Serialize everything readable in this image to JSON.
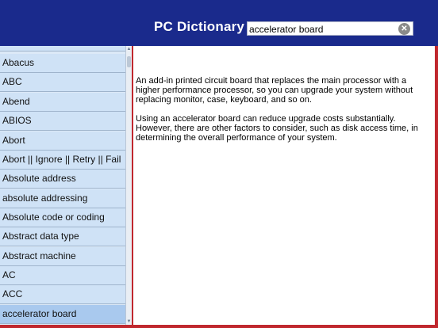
{
  "header": {
    "title": "PC Dictionary",
    "search_value": "accelerator board",
    "clear_icon": "⊗"
  },
  "sidebar": {
    "partial_top_item": "Abacus",
    "items": [
      {
        "label": "Abacus"
      },
      {
        "label": "ABC"
      },
      {
        "label": "Abend"
      },
      {
        "label": "ABIOS"
      },
      {
        "label": "Abort"
      },
      {
        "label": "Abort || Ignore || Retry || Fail"
      },
      {
        "label": "Absolute address"
      },
      {
        "label": "absolute addressing"
      },
      {
        "label": "Absolute code or coding"
      },
      {
        "label": "Abstract data type"
      },
      {
        "label": "Abstract machine"
      },
      {
        "label": "AC"
      },
      {
        "label": "ACC"
      },
      {
        "label": "accelerator board",
        "selected": true
      }
    ]
  },
  "definition": {
    "paragraph1": "An add-in printed circuit board that replaces the main processor with a higher performance processor, so you can upgrade your system without replacing monitor, case, keyboard, and so on.",
    "paragraph2": "Using an accelerator board can reduce upgrade costs substantially. However, there are other factors to consider, such as disk access time, in determining the overall performance of your system."
  },
  "colors": {
    "header_bg": "#1a2a8c",
    "accent_red": "#c0282e",
    "list_bg": "#cfe2f6",
    "selected_bg": "#a9c9ee"
  }
}
